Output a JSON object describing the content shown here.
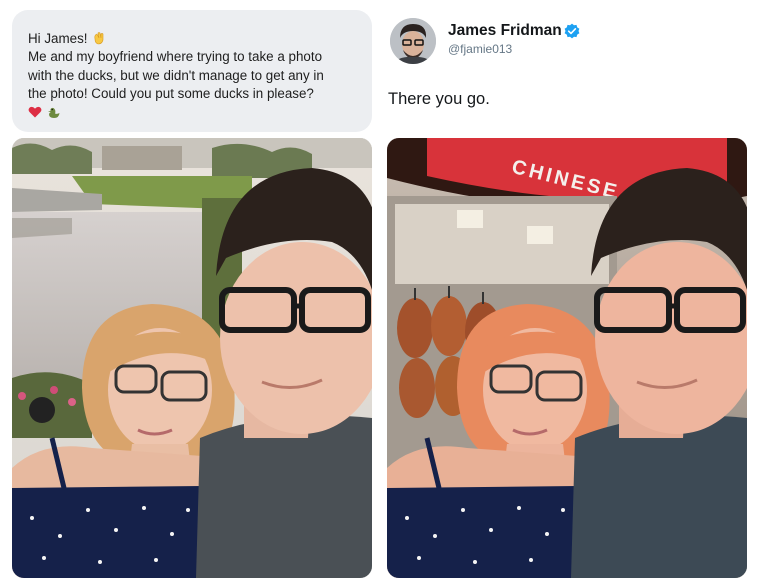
{
  "request": {
    "lines": [
      "Hi James!",
      "Me and my boyfriend where trying to take a photo",
      "with the ducks, but we didn't manage to get any in",
      "the photo! Could you put some ducks in please?"
    ],
    "icons": [
      "waving-hand-icon",
      "red-heart-icon",
      "duck-icon"
    ]
  },
  "reply": {
    "name": "James Fridman",
    "handle": "@fjamie013",
    "text": "There you go.",
    "verified_color": "#1da1f2"
  },
  "photo_right": {
    "sign_text": "CHINESE",
    "sign_color": "#d8333a"
  }
}
